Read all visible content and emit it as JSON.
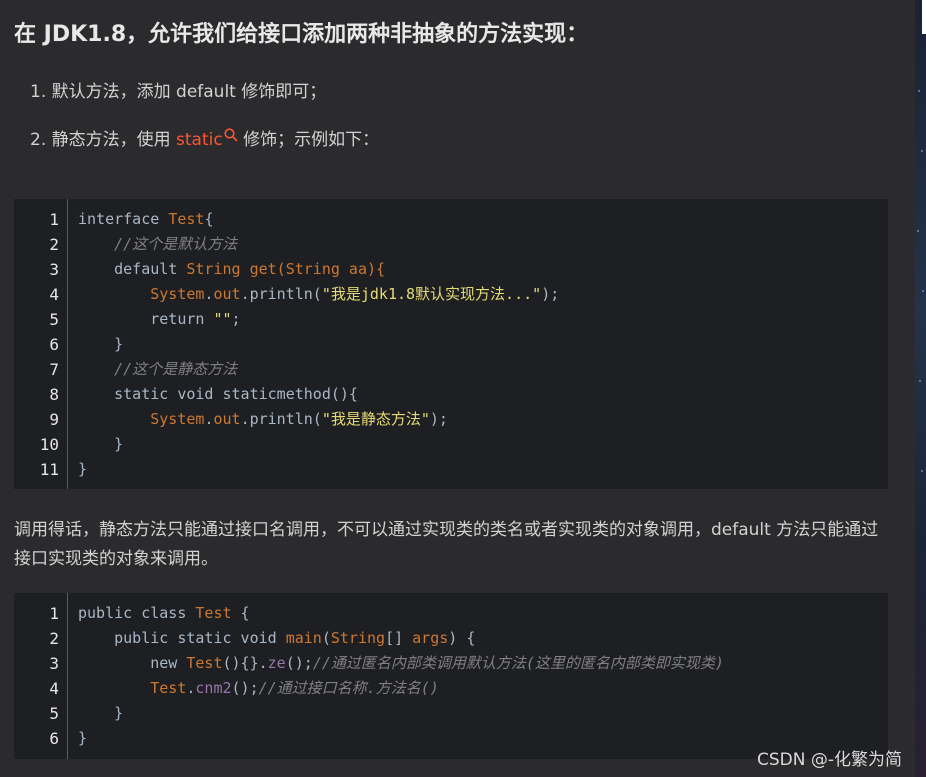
{
  "heading": "在 JDK1.8，允许我们给接口添加两种非抽象的方法实现：",
  "list": {
    "item1": "1. 默认方法，添加 default 修饰即可；",
    "item2_prefix": "2. 静态方法，使用 ",
    "item2_link": "static",
    "item2_suffix": " 修饰；示例如下：",
    "search_icon": "search-icon"
  },
  "code1": {
    "line_numbers": [
      "1",
      "2",
      "3",
      "4",
      "5",
      "6",
      "7",
      "8",
      "9",
      "10",
      "11"
    ],
    "l1": {
      "a": "interface ",
      "b": "Test",
      "c": "{"
    },
    "l2": {
      "indent": "    ",
      "comment": "//这个是默认方法"
    },
    "l3": {
      "indent": "    ",
      "a": "default ",
      "b": "String",
      "c": " get(",
      "d": "String",
      "e": " aa){"
    },
    "l4": {
      "indent": "        ",
      "a": "System",
      "b": ".",
      "c": "out",
      ".d": ".",
      "e": "println(",
      "f": "\"我是jdk1.8默认实现方法...\"",
      "g": ");"
    },
    "l5": {
      "indent": "        ",
      "a": "return ",
      "b": "\"\"",
      "c": ";"
    },
    "l6": {
      "indent": "    ",
      "a": "}"
    },
    "l7": {
      "indent": "    ",
      "comment": "//这个是静态方法"
    },
    "l8": {
      "indent": "    ",
      "a": "static void staticmethod(){"
    },
    "l9": {
      "indent": "        ",
      "a": "System",
      "b": ".",
      "c": "out",
      "d": ".",
      "e": "println(",
      "f": "\"我是静态方法\"",
      "g": ");"
    },
    "l10": {
      "indent": "    ",
      "a": "}"
    },
    "l11": {
      "a": "}"
    }
  },
  "paragraph": "调用得话，静态方法只能通过接口名调用，不可以通过实现类的类名或者实现类的对象调用，default 方法只能通过接口实现类的对象来调用。",
  "code2": {
    "line_numbers": [
      "1",
      "2",
      "3",
      "4",
      "5",
      "6"
    ],
    "l1": {
      "a": "public class ",
      "b": "Test",
      "c": " {"
    },
    "l2": {
      "indent": "    ",
      "a": "public static void ",
      "b": "main",
      "c": "(",
      "d": "String",
      "e": "[] ",
      "f": "args",
      ".g": ") {",
      "g": ") {"
    },
    "l3": {
      "indent": "        ",
      "a": "new ",
      "b": "Test",
      "c": "(){}.",
      "d": "ze",
      "e": "();",
      "comment": "//通过匿名内部类调用默认方法(这里的匿名内部类即实现类)"
    },
    "l4": {
      "indent": "        ",
      "a": "Test",
      "b": ".",
      "c": "cnm2",
      "d": "();",
      "comment": "//通过接口名称.方法名()"
    },
    "l5": {
      "indent": "    ",
      "a": "}"
    },
    "l6": {
      "a": "}"
    }
  },
  "watermark": "CSDN @-化繁为简",
  "colors": {
    "keyword": "#a9b7c6",
    "class": "#cc7832",
    "string": "#e6db74",
    "comment": "#808080",
    "link": "#fc5531"
  }
}
